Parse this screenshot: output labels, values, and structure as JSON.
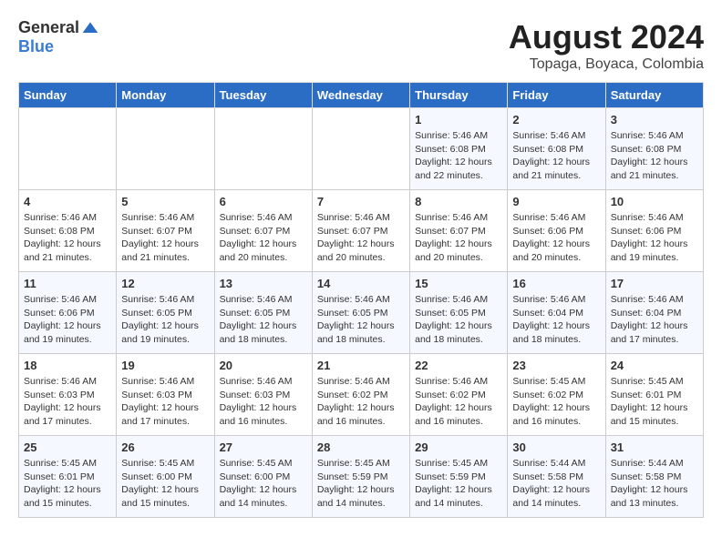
{
  "logo": {
    "general": "General",
    "blue": "Blue"
  },
  "title": {
    "month_year": "August 2024",
    "location": "Topaga, Boyaca, Colombia"
  },
  "days_of_week": [
    "Sunday",
    "Monday",
    "Tuesday",
    "Wednesday",
    "Thursday",
    "Friday",
    "Saturday"
  ],
  "weeks": [
    [
      {
        "day": "",
        "info": ""
      },
      {
        "day": "",
        "info": ""
      },
      {
        "day": "",
        "info": ""
      },
      {
        "day": "",
        "info": ""
      },
      {
        "day": "1",
        "info": "Sunrise: 5:46 AM\nSunset: 6:08 PM\nDaylight: 12 hours\nand 22 minutes."
      },
      {
        "day": "2",
        "info": "Sunrise: 5:46 AM\nSunset: 6:08 PM\nDaylight: 12 hours\nand 21 minutes."
      },
      {
        "day": "3",
        "info": "Sunrise: 5:46 AM\nSunset: 6:08 PM\nDaylight: 12 hours\nand 21 minutes."
      }
    ],
    [
      {
        "day": "4",
        "info": "Sunrise: 5:46 AM\nSunset: 6:08 PM\nDaylight: 12 hours\nand 21 minutes."
      },
      {
        "day": "5",
        "info": "Sunrise: 5:46 AM\nSunset: 6:07 PM\nDaylight: 12 hours\nand 21 minutes."
      },
      {
        "day": "6",
        "info": "Sunrise: 5:46 AM\nSunset: 6:07 PM\nDaylight: 12 hours\nand 20 minutes."
      },
      {
        "day": "7",
        "info": "Sunrise: 5:46 AM\nSunset: 6:07 PM\nDaylight: 12 hours\nand 20 minutes."
      },
      {
        "day": "8",
        "info": "Sunrise: 5:46 AM\nSunset: 6:07 PM\nDaylight: 12 hours\nand 20 minutes."
      },
      {
        "day": "9",
        "info": "Sunrise: 5:46 AM\nSunset: 6:06 PM\nDaylight: 12 hours\nand 20 minutes."
      },
      {
        "day": "10",
        "info": "Sunrise: 5:46 AM\nSunset: 6:06 PM\nDaylight: 12 hours\nand 19 minutes."
      }
    ],
    [
      {
        "day": "11",
        "info": "Sunrise: 5:46 AM\nSunset: 6:06 PM\nDaylight: 12 hours\nand 19 minutes."
      },
      {
        "day": "12",
        "info": "Sunrise: 5:46 AM\nSunset: 6:05 PM\nDaylight: 12 hours\nand 19 minutes."
      },
      {
        "day": "13",
        "info": "Sunrise: 5:46 AM\nSunset: 6:05 PM\nDaylight: 12 hours\nand 18 minutes."
      },
      {
        "day": "14",
        "info": "Sunrise: 5:46 AM\nSunset: 6:05 PM\nDaylight: 12 hours\nand 18 minutes."
      },
      {
        "day": "15",
        "info": "Sunrise: 5:46 AM\nSunset: 6:05 PM\nDaylight: 12 hours\nand 18 minutes."
      },
      {
        "day": "16",
        "info": "Sunrise: 5:46 AM\nSunset: 6:04 PM\nDaylight: 12 hours\nand 18 minutes."
      },
      {
        "day": "17",
        "info": "Sunrise: 5:46 AM\nSunset: 6:04 PM\nDaylight: 12 hours\nand 17 minutes."
      }
    ],
    [
      {
        "day": "18",
        "info": "Sunrise: 5:46 AM\nSunset: 6:03 PM\nDaylight: 12 hours\nand 17 minutes."
      },
      {
        "day": "19",
        "info": "Sunrise: 5:46 AM\nSunset: 6:03 PM\nDaylight: 12 hours\nand 17 minutes."
      },
      {
        "day": "20",
        "info": "Sunrise: 5:46 AM\nSunset: 6:03 PM\nDaylight: 12 hours\nand 16 minutes."
      },
      {
        "day": "21",
        "info": "Sunrise: 5:46 AM\nSunset: 6:02 PM\nDaylight: 12 hours\nand 16 minutes."
      },
      {
        "day": "22",
        "info": "Sunrise: 5:46 AM\nSunset: 6:02 PM\nDaylight: 12 hours\nand 16 minutes."
      },
      {
        "day": "23",
        "info": "Sunrise: 5:45 AM\nSunset: 6:02 PM\nDaylight: 12 hours\nand 16 minutes."
      },
      {
        "day": "24",
        "info": "Sunrise: 5:45 AM\nSunset: 6:01 PM\nDaylight: 12 hours\nand 15 minutes."
      }
    ],
    [
      {
        "day": "25",
        "info": "Sunrise: 5:45 AM\nSunset: 6:01 PM\nDaylight: 12 hours\nand 15 minutes."
      },
      {
        "day": "26",
        "info": "Sunrise: 5:45 AM\nSunset: 6:00 PM\nDaylight: 12 hours\nand 15 minutes."
      },
      {
        "day": "27",
        "info": "Sunrise: 5:45 AM\nSunset: 6:00 PM\nDaylight: 12 hours\nand 14 minutes."
      },
      {
        "day": "28",
        "info": "Sunrise: 5:45 AM\nSunset: 5:59 PM\nDaylight: 12 hours\nand 14 minutes."
      },
      {
        "day": "29",
        "info": "Sunrise: 5:45 AM\nSunset: 5:59 PM\nDaylight: 12 hours\nand 14 minutes."
      },
      {
        "day": "30",
        "info": "Sunrise: 5:44 AM\nSunset: 5:58 PM\nDaylight: 12 hours\nand 14 minutes."
      },
      {
        "day": "31",
        "info": "Sunrise: 5:44 AM\nSunset: 5:58 PM\nDaylight: 12 hours\nand 13 minutes."
      }
    ]
  ]
}
